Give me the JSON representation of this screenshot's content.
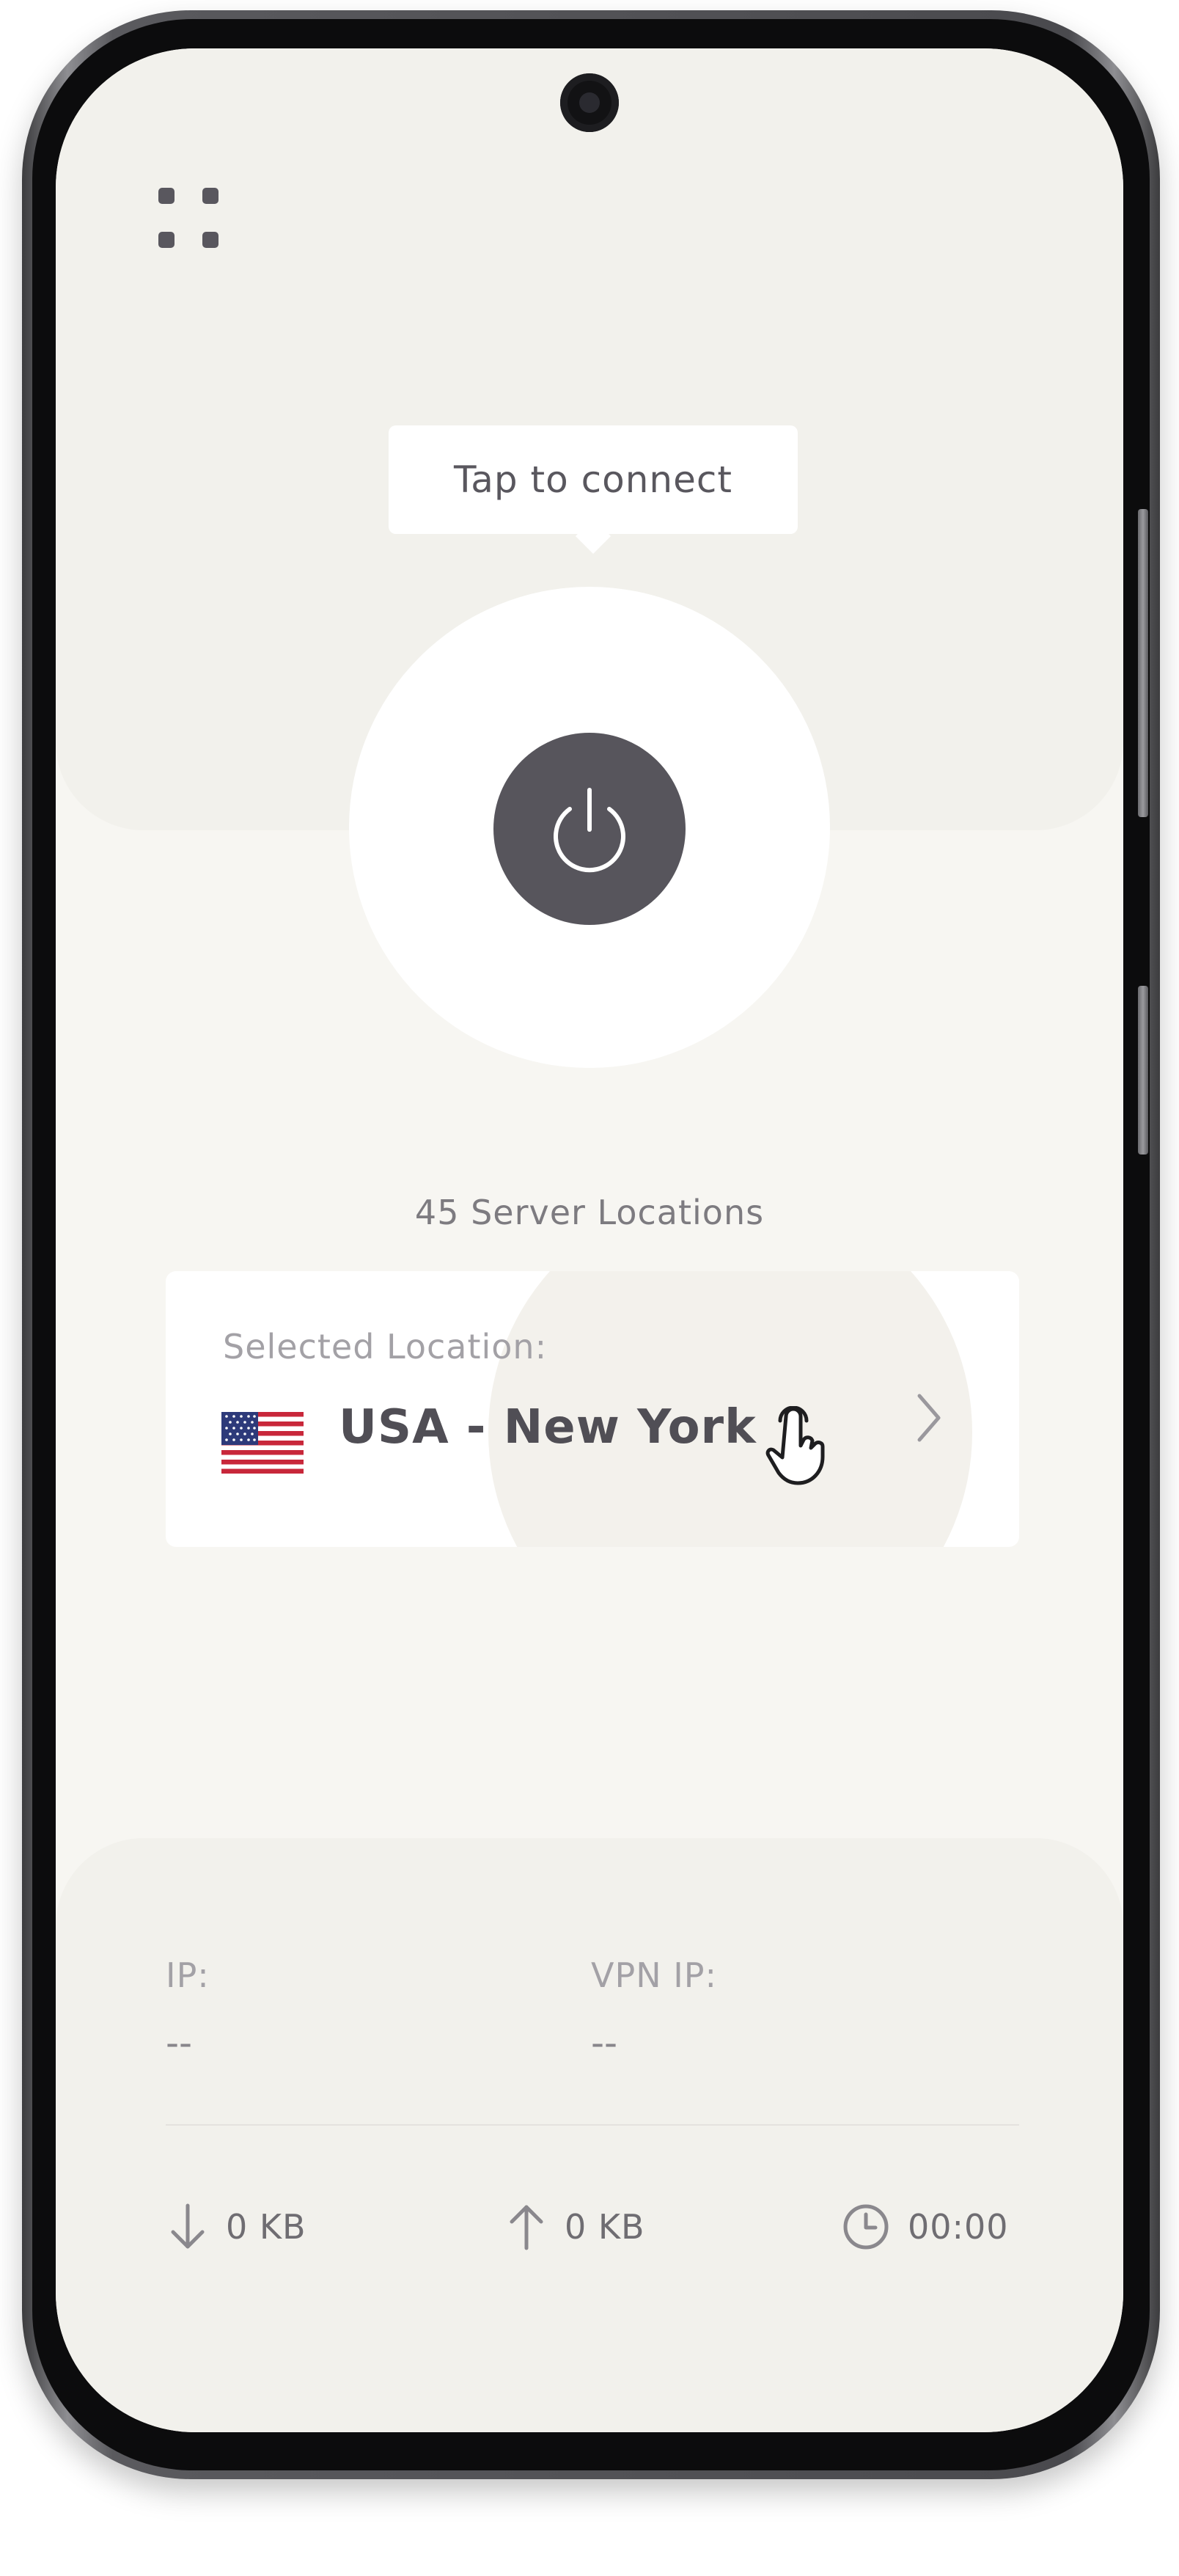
{
  "header": {
    "menu_icon": "grid-four-dots-icon"
  },
  "connect": {
    "tooltip": "Tap to connect",
    "power_icon": "power-icon",
    "button_color": "#57555c"
  },
  "servers": {
    "count_label": "45 Server Locations"
  },
  "location": {
    "label": "Selected Location:",
    "name": "USA - New York",
    "flag_icon": "usa-flag-icon",
    "hand_icon": "tap-hand-icon",
    "chevron_icon": "chevron-right-icon"
  },
  "stats": {
    "ip_label": "IP:",
    "ip_value": "--",
    "vpn_ip_label": "VPN IP:",
    "vpn_ip_value": "--",
    "download": "0 KB",
    "upload": "0 KB",
    "duration": "00:00",
    "download_icon": "arrow-down-icon",
    "upload_icon": "arrow-up-icon",
    "clock_icon": "clock-icon"
  },
  "colors": {
    "screen_bg": "#f7f6f2",
    "card_bg": "#ffffff",
    "text_dark": "#504e55",
    "text_muted": "#a3a1a6"
  }
}
